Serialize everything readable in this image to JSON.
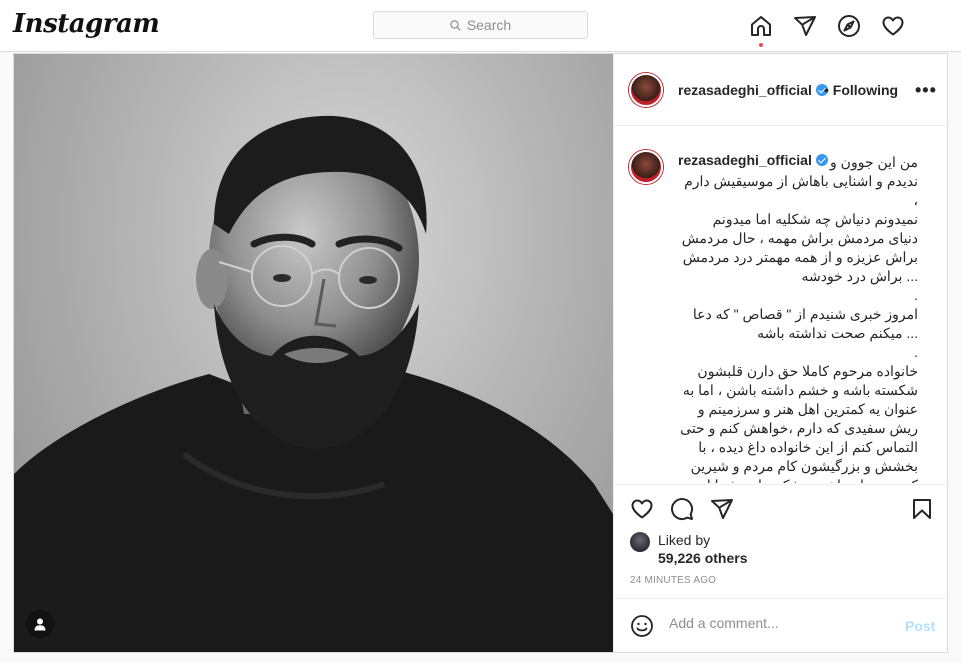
{
  "nav": {
    "logo": "Instagram",
    "search_placeholder": "Search",
    "icons": [
      "home-icon",
      "direct-icon",
      "explore-icon",
      "activity-heart-icon"
    ]
  },
  "post": {
    "username": "rezasadeghi_official",
    "verified": true,
    "follow_status": "• Following",
    "more": "•••",
    "caption": "من این جوون و\nندیدم و اشنایی باهاش از موسیقیش دارم ،\nنمیدونم دنیاش چه شکلیه اما میدونم\nدنیای مردمش براش مهمه ، حال مردمش\nبراش عزیزه و از همه مهمتر درد مردمش\n... براش درد خودشه\n.\nامروز خبری شنیدم از \" قصاص \" که دعا\n... میکنم صحت نداشته باشه\n.\nخانواده مرحوم کاملا حق دارن قلبشون\nشکسته باشه و خشم داشته باشن ، اما به\nعنوان یه کمترین اهل هنر و سرزمینم و\nریش سفیدی که دارم ،خواهش کنم و حتی\nالتماس کنم از این خانواده داغ دیده ، با\nبخشش و بزرگیشون کام مردم و شیرین\nکنن ، روزای تلخیه و شک ندارم شما این\n، تلخی رو از همه بیشتر لمس کردین",
    "liked_by_label": "Liked by",
    "likes_count": "59,226 others",
    "time_ago": "24 MINUTES AGO",
    "comment_placeholder": "Add a comment...",
    "post_label": "Post"
  },
  "colors": {
    "accent_blue": "#3897f0",
    "post_disabled": "#b2dffc",
    "notification_dot": "#ed4956"
  }
}
